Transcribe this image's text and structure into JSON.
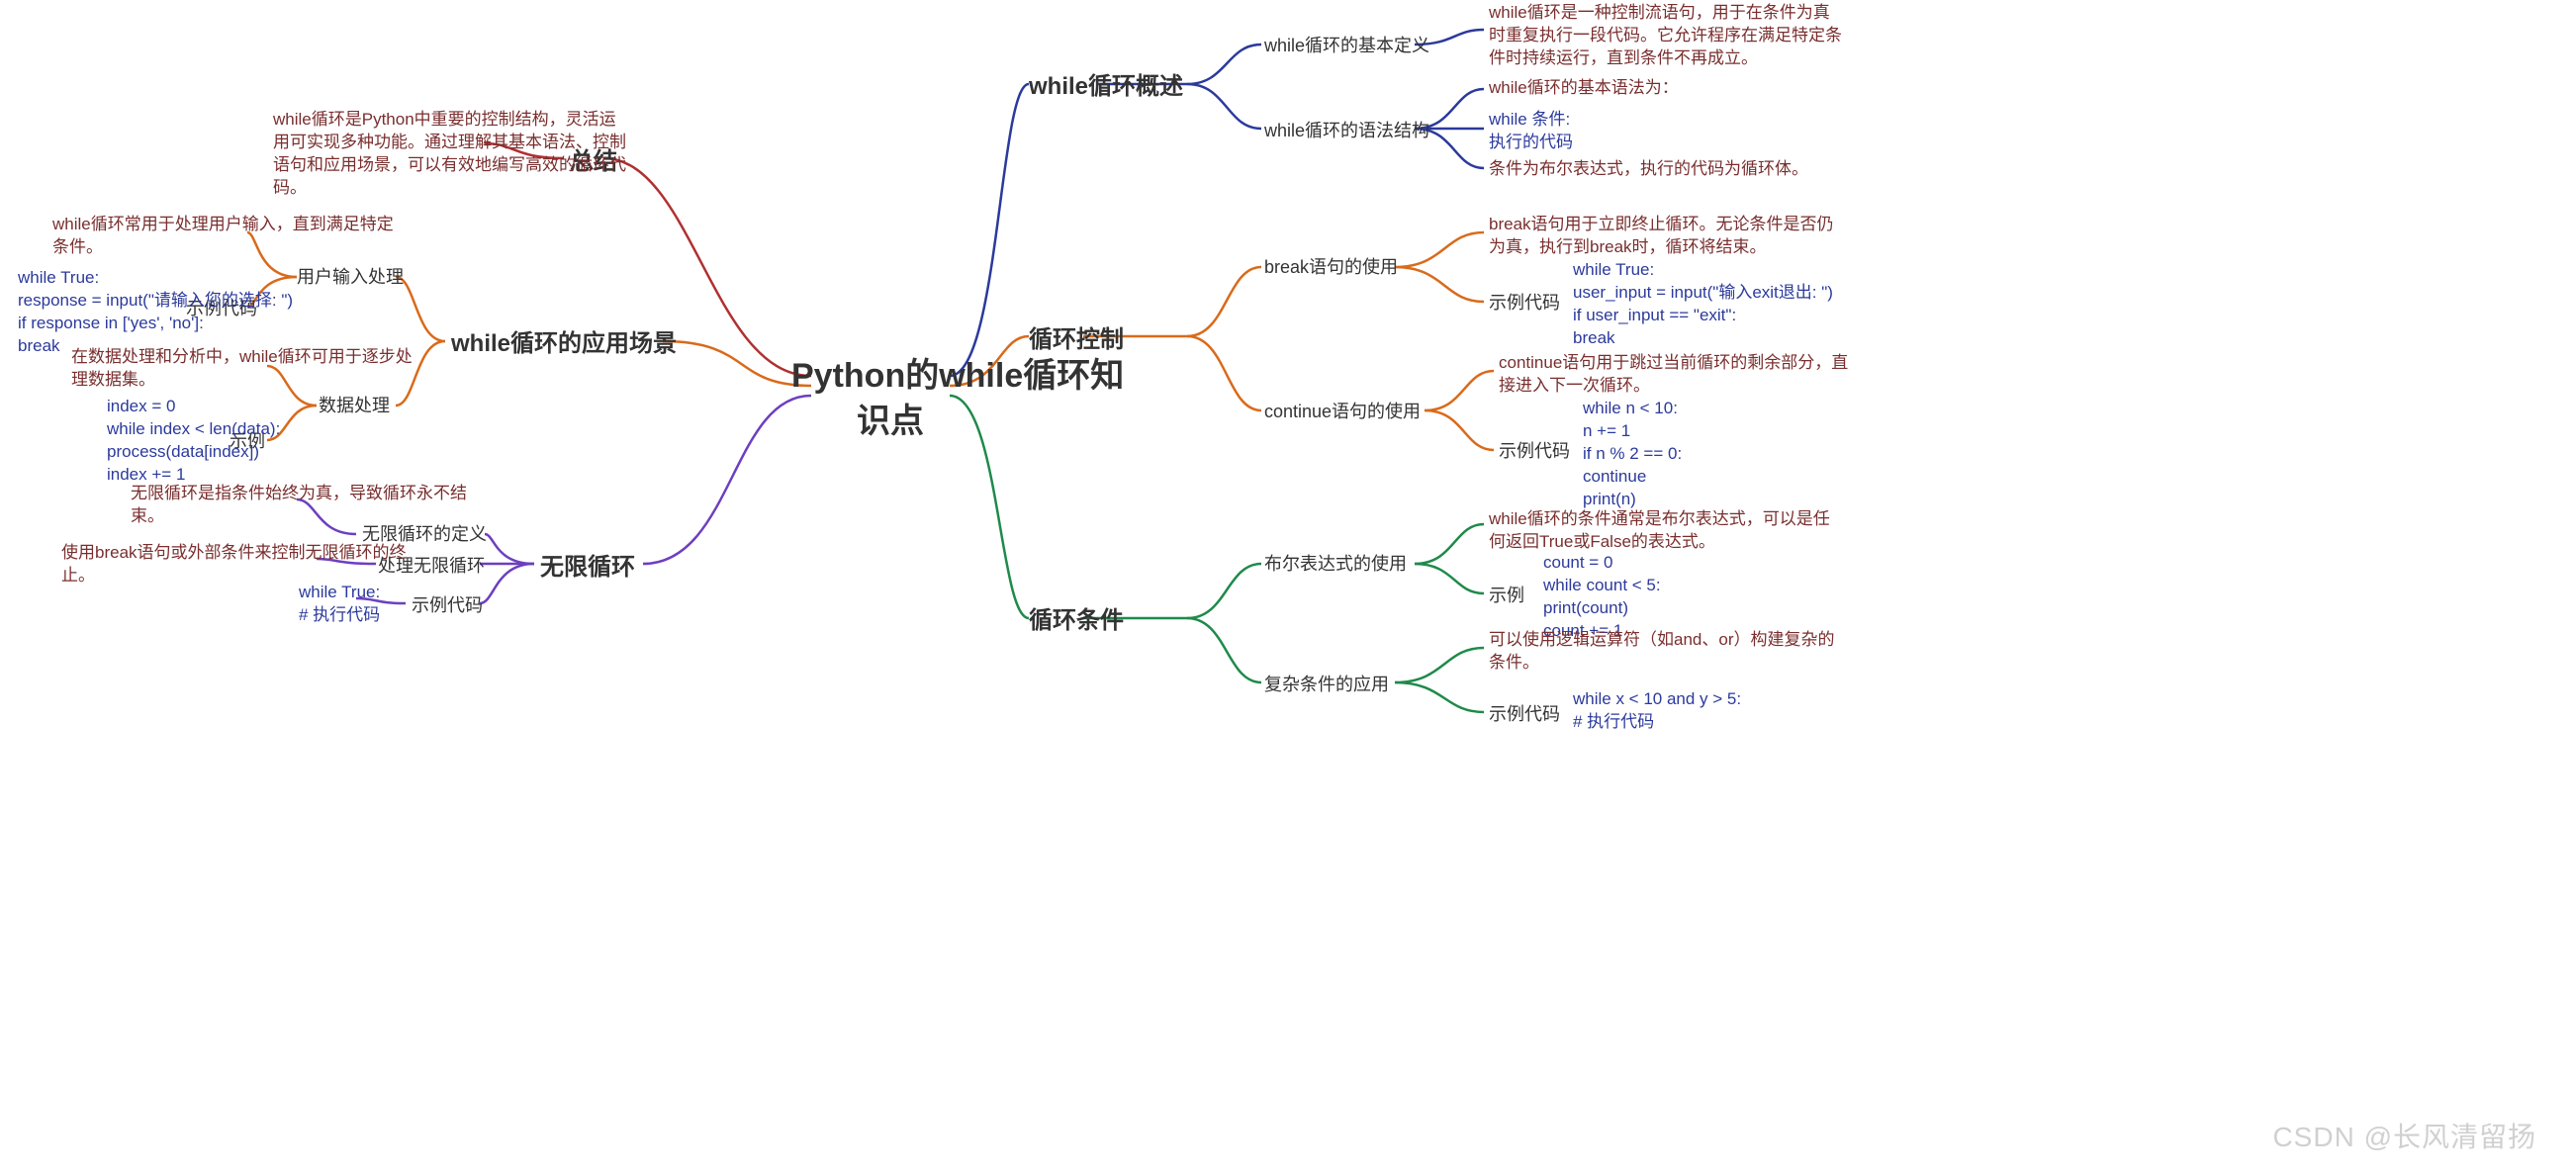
{
  "root": "Python的while循环知\n识点",
  "watermark": "CSDN @长风清留扬",
  "summary_title": "总结",
  "summary_text": "while循环是Python中重要的控制结构，灵活运\n用可实现多种功能。通过理解其基本语法、控制\n语句和应用场景，可以有效地编写高效的循环代\n码。",
  "app_title": "while循环的应用场景",
  "app_input_title": "用户输入处理",
  "app_input_text": "while循环常用于处理用户输入，直到满足特定\n条件。",
  "app_input_code_label": "示例代码",
  "app_input_code": "while True:\nresponse = input(\"请输入您的选择: \")\nif response in ['yes', 'no']:\nbreak",
  "app_data_title": "数据处理",
  "app_data_text": "在数据处理和分析中，while循环可用于逐步处\n理数据集。",
  "app_data_code_label": "示例",
  "app_data_code": "index = 0\nwhile index < len(data):\nprocess(data[index])\nindex += 1",
  "inf_title": "无限循环",
  "inf_def_title": "无限循环的定义",
  "inf_def_text": "无限循环是指条件始终为真，导致循环永不结\n束。",
  "inf_handle_title": "处理无限循环",
  "inf_handle_text": "使用break语句或外部条件来控制无限循环的终\n止。",
  "inf_code_label": "示例代码",
  "inf_code": "while True:\n# 执行代码",
  "ov_title": "while循环概述",
  "ov_def_title": "while循环的基本定义",
  "ov_def_text": "while循环是一种控制流语句，用于在条件为真\n时重复执行一段代码。它允许程序在满足特定条\n件时持续运行，直到条件不再成立。",
  "ov_syn_title": "while循环的语法结构",
  "ov_syn_text": "while循环的基本语法为：",
  "ov_syn_code": "while 条件:\n执行的代码",
  "ov_syn_note": "条件为布尔表达式，执行的代码为循环体。",
  "ctrl_title": "循环控制",
  "ctrl_break_title": "break语句的使用",
  "ctrl_break_text": "break语句用于立即终止循环。无论条件是否仍\n为真，执行到break时，循环将结束。",
  "ctrl_break_code_label": "示例代码",
  "ctrl_break_code": "while True:\nuser_input = input(\"输入exit退出: \")\nif user_input == \"exit\":\nbreak",
  "ctrl_cont_title": "continue语句的使用",
  "ctrl_cont_text": "continue语句用于跳过当前循环的剩余部分，直\n接进入下一次循环。",
  "ctrl_cont_code_label": "示例代码",
  "ctrl_cont_code": "while n < 10:\nn += 1\nif n % 2 == 0:\ncontinue\nprint(n)",
  "cond_title": "循环条件",
  "cond_bool_title": "布尔表达式的使用",
  "cond_bool_text": "while循环的条件通常是布尔表达式，可以是任\n何返回True或False的表达式。",
  "cond_bool_code_label": "示例",
  "cond_bool_code": "count = 0\nwhile count < 5:\nprint(count)\ncount += 1",
  "cond_complex_title": "复杂条件的应用",
  "cond_complex_text": "可以使用逻辑运算符（如and、or）构建复杂的\n条件。",
  "cond_complex_code_label": "示例代码",
  "cond_complex_code": "while x < 10 and y > 5:\n# 执行代码"
}
